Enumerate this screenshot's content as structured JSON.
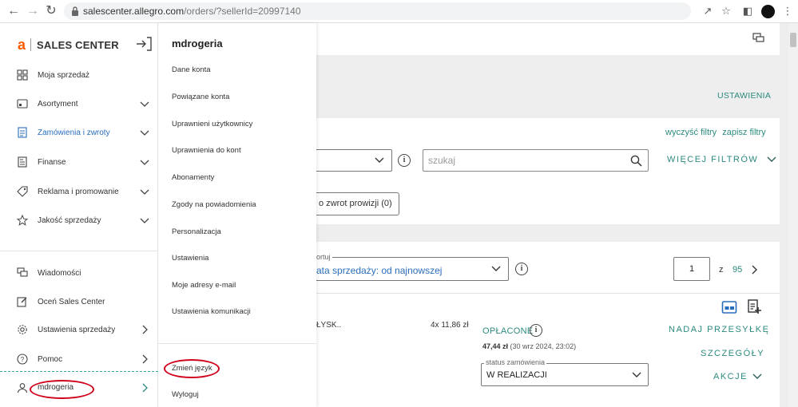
{
  "browser": {
    "url_host": "salescenter.allegro.com",
    "url_path": "/orders/?sellerId=20997140"
  },
  "brand": {
    "letter": "a",
    "name": "SALES CENTER"
  },
  "sidebar": {
    "items": [
      {
        "label": "Moja sprzedaż",
        "icon": "grid-icon"
      },
      {
        "label": "Asortyment",
        "icon": "inventory-icon"
      },
      {
        "label": "Zamówienia i zwroty",
        "icon": "orders-icon"
      },
      {
        "label": "Finanse",
        "icon": "finance-icon"
      },
      {
        "label": "Reklama i promowanie",
        "icon": "tag-icon"
      },
      {
        "label": "Jakość sprzedaży",
        "icon": "star-icon"
      }
    ],
    "bottom_items": [
      {
        "label": "Wiadomości",
        "icon": "messages-icon"
      },
      {
        "label": "Oceń Sales Center",
        "icon": "edit-icon"
      },
      {
        "label": "Ustawienia sprzedaży",
        "icon": "gear-icon"
      },
      {
        "label": "Pomoc",
        "icon": "help-icon"
      }
    ],
    "user_label": "mdrogeria"
  },
  "submenu": {
    "title": "mdrogeria",
    "items": [
      "Dane konta",
      "Powiązane konta",
      "Uprawnieni użytkownicy",
      "Uprawnienia do kont",
      "Abonamenty",
      "Zgody na powiadomienia",
      "Personalizacja",
      "Ustawienia",
      "Moje adresy e-mail",
      "Ustawienia komunikacji"
    ],
    "change_language": "Zmień język",
    "logout": "Wyloguj"
  },
  "main": {
    "settings_link": "USTAWIENIA",
    "clear_filters": "wyczyść filtry",
    "save_filters": "zapisz filtry",
    "search_placeholder": "szukaj",
    "more_filters": "WIĘCEJ FILTRÓW",
    "chip_label": "o zwrot prowizji (0)",
    "sort_label": "ortuj",
    "sort_value": "ata sprzedaży: od najnowszej",
    "page_current": "1",
    "page_of": "z",
    "page_total": "95"
  },
  "order": {
    "item_name": "ŁYSK..",
    "quantity_price": "4x 11,86 zł",
    "payment_status": "OPŁACONE",
    "total": "47,44 zł",
    "date": "(30 wrz 2024, 23:02)",
    "status_label": "status zamówienia",
    "status_value": "W REALIZACJI",
    "actions": [
      "NADAJ PRZESYŁKĘ",
      "SZCZEGÓŁY",
      "AKCJE"
    ]
  },
  "colors": {
    "accent_teal": "#2b8a7e",
    "link_blue": "#2a6ebb",
    "brand_orange": "#ff5a00",
    "annotation_red": "#d0021b"
  }
}
